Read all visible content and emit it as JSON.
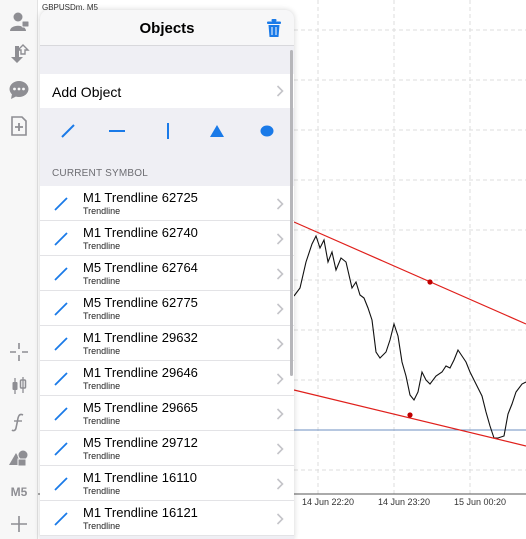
{
  "chart": {
    "symbol": "GBPUSDm, M5",
    "time_labels": [
      "14 Jun 22:20",
      "14 Jun 23:20",
      "15 Jun 00:20"
    ]
  },
  "toolbar": {
    "timeframe_label": "M5",
    "icons": [
      "account-icon",
      "trade-icon",
      "chat-icon",
      "new-order-icon",
      "crosshair-icon",
      "indicators-icon",
      "function-icon",
      "objects-icon",
      "timeframe-label",
      "add-icon"
    ]
  },
  "panel": {
    "title": "Objects",
    "add_object_label": "Add Object",
    "tools": [
      "trendline-tool",
      "horizontal-line-tool",
      "vertical-line-tool",
      "triangle-tool",
      "ellipse-tool"
    ],
    "section_title": "CURRENT SYMBOL",
    "items": [
      {
        "title": "M1 Trendline 62725",
        "type": "Trendline"
      },
      {
        "title": "M1 Trendline 62740",
        "type": "Trendline"
      },
      {
        "title": "M5 Trendline 62764",
        "type": "Trendline"
      },
      {
        "title": "M5 Trendline 62775",
        "type": "Trendline"
      },
      {
        "title": "M1 Trendline 29632",
        "type": "Trendline"
      },
      {
        "title": "M1 Trendline 29646",
        "type": "Trendline"
      },
      {
        "title": "M5 Trendline 29665",
        "type": "Trendline"
      },
      {
        "title": "M5 Trendline 29712",
        "type": "Trendline"
      },
      {
        "title": "M1 Trendline 16110",
        "type": "Trendline"
      },
      {
        "title": "M1 Trendline 16121",
        "type": "Trendline"
      }
    ]
  },
  "colors": {
    "accent": "#1a7ae8",
    "trendline_red": "#e0201c",
    "chevron": "#c4c4c9"
  }
}
